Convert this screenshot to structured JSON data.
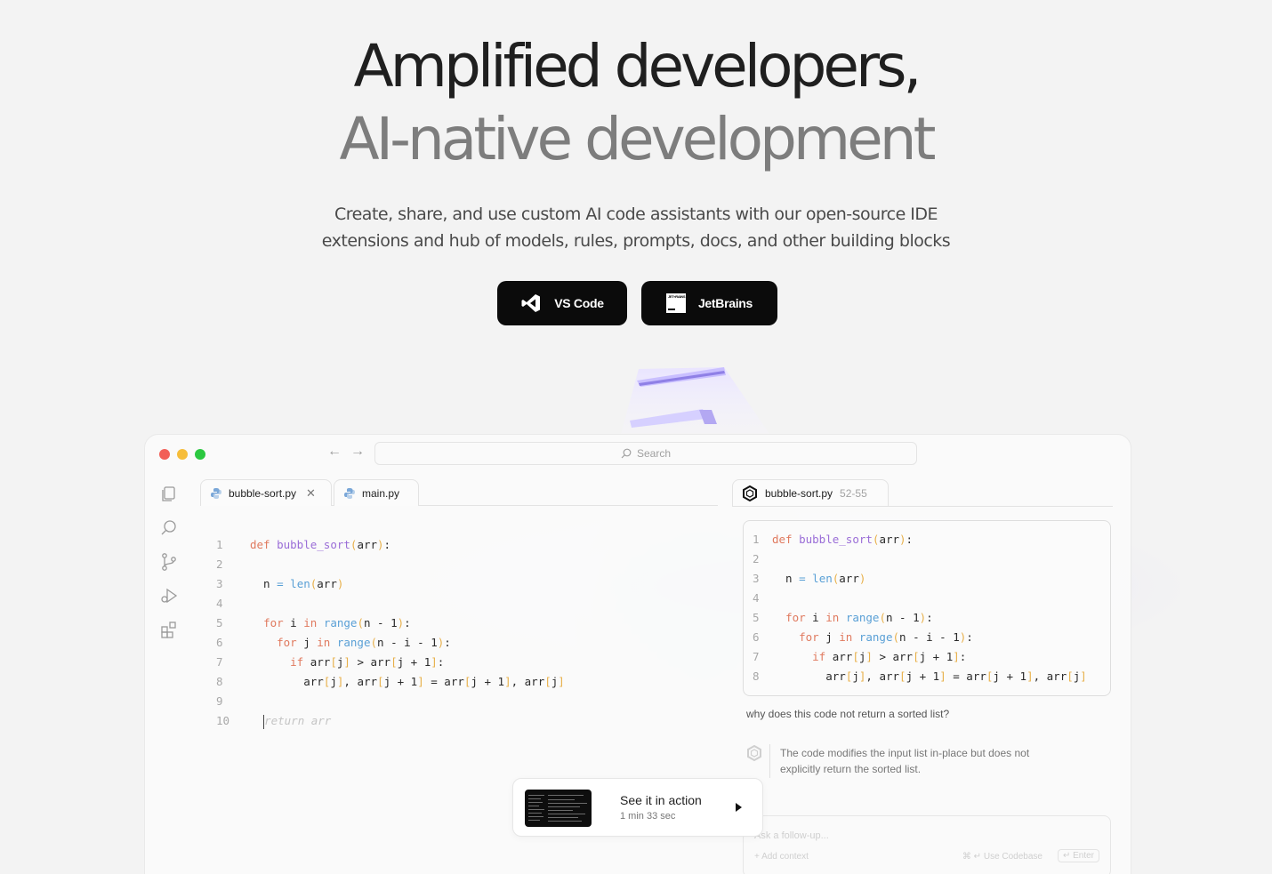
{
  "hero": {
    "line1": "Amplified developers,",
    "line2": "AI-native development",
    "subtitle_line1": "Create, share, and use custom AI code assistants with our open-source IDE",
    "subtitle_line2": "extensions and hub of models, rules, prompts, docs, and other building blocks"
  },
  "cta": {
    "vscode_label": "VS Code",
    "jetbrains_label": "JetBrains"
  },
  "ide": {
    "search_placeholder": "Search",
    "tabs": [
      {
        "label": "bubble-sort.py"
      },
      {
        "label": "main.py"
      }
    ],
    "line_numbers": [
      "1",
      "2",
      "3",
      "4",
      "5",
      "6",
      "7",
      "8",
      "9",
      "10"
    ],
    "ghost_text": "return arr",
    "chat": {
      "tab_file": "bubble-sort.py",
      "tab_range": "52-55",
      "line_numbers": [
        "1",
        "2",
        "3",
        "4",
        "5",
        "6",
        "7",
        "8"
      ],
      "question": "why does this code not return a sorted list?",
      "answer": "The code modifies the input list in-place but does not explicitly return the sorted list.",
      "followup_placeholder": "Ask a follow-up...",
      "add_context": "+ Add context",
      "use_codebase": "⌘ ↵ Use Codebase",
      "enter": "↵ Enter"
    }
  },
  "video": {
    "title": "See it in action",
    "duration": "1 min 33 sec"
  },
  "colors": {
    "keyword": "#e07a5f",
    "function": "#9a6dd7",
    "builtin": "#5aa0d6",
    "bracket": "#e8b04a",
    "traffic_red": "#f25f57",
    "traffic_yellow": "#f6bd3a",
    "traffic_green": "#2bc840"
  }
}
